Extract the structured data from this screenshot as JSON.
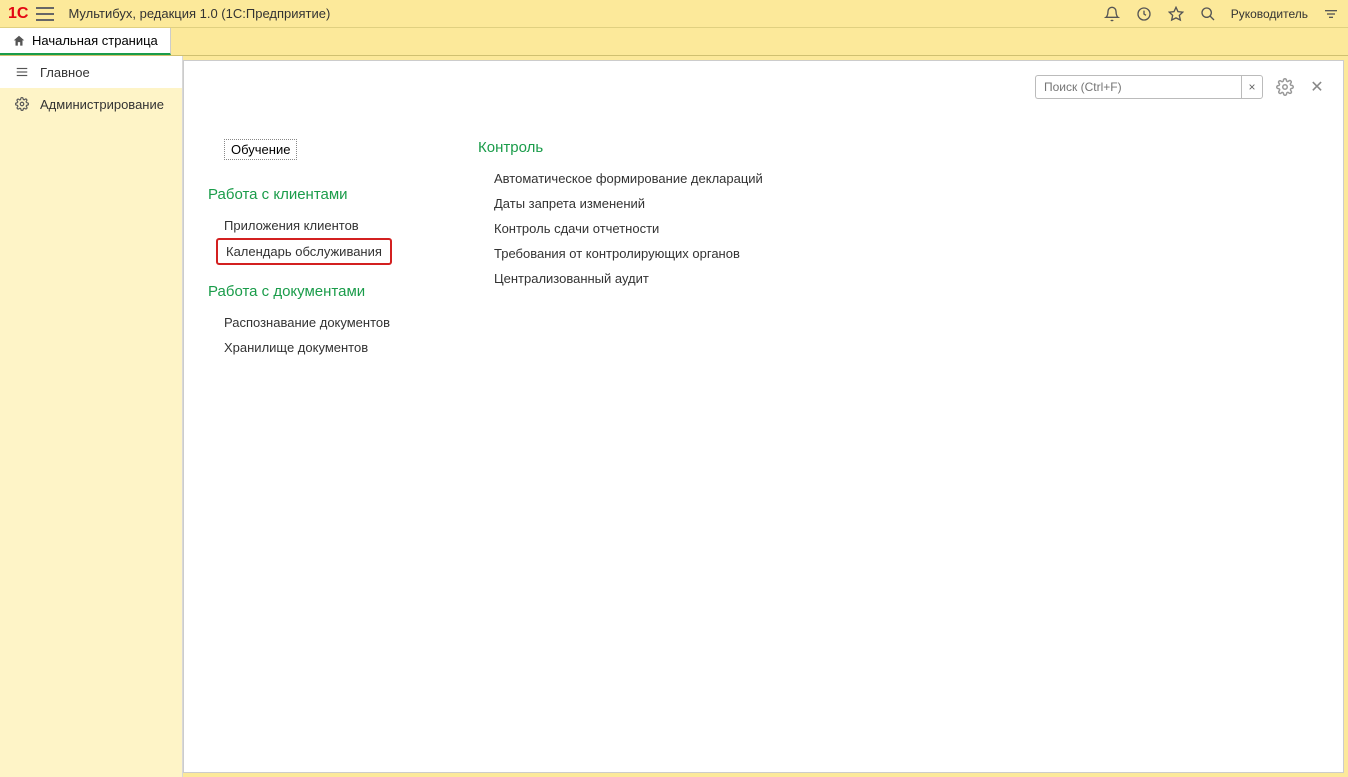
{
  "titlebar": {
    "app_title": "Мультибух, редакция 1.0  (1С:Предприятие)",
    "user": "Руководитель"
  },
  "tabs": {
    "home": "Начальная страница"
  },
  "sidebar": {
    "main": "Главное",
    "admin": "Администрирование"
  },
  "search": {
    "placeholder": "Поиск (Ctrl+F)",
    "clear": "×"
  },
  "content": {
    "training": "Обучение",
    "clients_section": "Работа с клиентами",
    "clients_items": {
      "apps": "Приложения клиентов",
      "calendar": "Календарь обслуживания"
    },
    "docs_section": "Работа с документами",
    "docs_items": {
      "recognize": "Распознавание документов",
      "storage": "Хранилище документов"
    },
    "control_section": "Контроль",
    "control_items": {
      "autodecl": "Автоматическое формирование деклараций",
      "dates": "Даты запрета изменений",
      "reporting": "Контроль сдачи отчетности",
      "requirements": "Требования от контролирующих органов",
      "audit": "Централизованный аудит"
    }
  }
}
